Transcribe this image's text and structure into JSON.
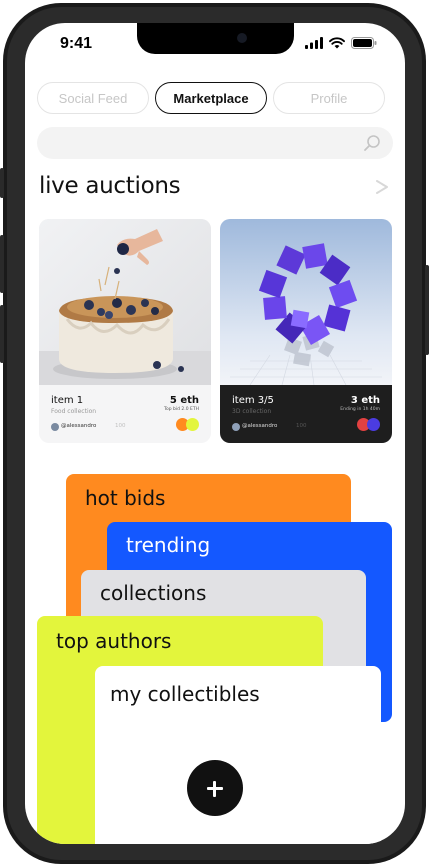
{
  "status_bar": {
    "time": "9:41"
  },
  "tabs": [
    {
      "label": "Social Feed",
      "active": false
    },
    {
      "label": "Marketplace",
      "active": true
    },
    {
      "label": "Profile",
      "active": false
    }
  ],
  "search": {
    "placeholder": ""
  },
  "live_auctions": {
    "title": "live auctions",
    "cards": [
      {
        "name": "item 1",
        "collection": "Food collection",
        "price": "5 eth",
        "meta": "Top bid 2.0 ETH",
        "user": "@alessandro",
        "stat": "100",
        "theme": "light"
      },
      {
        "name": "item 3/5",
        "collection": "3D collection",
        "price": "3 eth",
        "meta": "Ending in 1h 40m",
        "user": "@alessandro",
        "stat": "100",
        "theme": "dark"
      }
    ]
  },
  "categories": [
    {
      "label": "hot bids",
      "color": "#FF8A1F"
    },
    {
      "label": "trending",
      "color": "#1458FF"
    },
    {
      "label": "collections",
      "color": "#E1E1E4"
    },
    {
      "label": "top authors",
      "color": "#E3F53C"
    },
    {
      "label": "my collectibles",
      "color": "#FFFFFF"
    }
  ],
  "icons": [
    "signal-icon",
    "wifi-icon",
    "battery-icon",
    "search-icon",
    "chevron-right-icon",
    "plus-icon"
  ]
}
